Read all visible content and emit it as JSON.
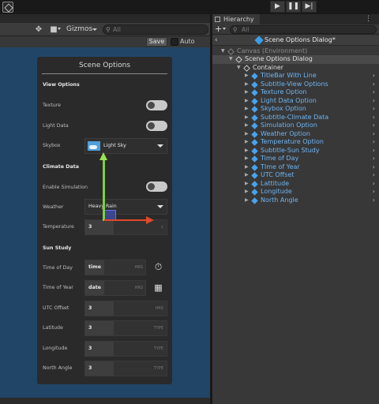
{
  "playbar": {
    "play": "▶",
    "pause": "❚❚",
    "step": "▶|"
  },
  "scene": {
    "toolbar": {
      "gizmos_label": "Gizmos",
      "search_placeholder": "All"
    },
    "save_label": "Save",
    "autosave_label": "Auto Save"
  },
  "dialog": {
    "title": "Scene Options",
    "sections": {
      "view_options": "View Options",
      "climate_data": "Climate Data",
      "sun_study": "Sun Study"
    },
    "texture_label": "Texture",
    "light_data_label": "Light Data",
    "skybox_label": "Skybox",
    "skybox_value": "Light Sky",
    "enable_simulation_label": "Enable Simulation",
    "weather_label": "Weather",
    "weather_value": "Heavy Rain",
    "temperature_label": "Temperature",
    "temperature_value": "3",
    "temperature_unit": "c",
    "time_of_day_label": "Time of Day",
    "time_of_day_value": "time",
    "time_of_day_unit": "HRS",
    "time_of_year_label": "Time of Year",
    "time_of_year_value": "date",
    "time_of_year_unit": "HRS",
    "utc_offset_label": "UTC Offset",
    "utc_offset_value": "3",
    "utc_offset_unit": "HRS",
    "latitude_label": "Latitude",
    "latitude_value": "3",
    "latitude_unit": "TYPE",
    "longitude_label": "Longitude",
    "longitude_value": "3",
    "longitude_unit": "TYPE",
    "north_angle_label": "North Angle",
    "north_angle_value": "3",
    "north_angle_unit": "TYPE",
    "toggles": {
      "texture": false,
      "light_data": false,
      "enable_simulation": false
    }
  },
  "hierarchy": {
    "tab_label": "Hierarchy",
    "search_placeholder": "All",
    "prefab_title": "Scene Options Dialog*",
    "rows": [
      {
        "label": "Canvas (Environment)",
        "depth": 0,
        "style": "gray",
        "expanded": true
      },
      {
        "label": "Scene Options Dialog",
        "depth": 1,
        "style": "white",
        "expanded": true
      },
      {
        "label": "Container",
        "depth": 2,
        "style": "white",
        "expanded": true
      },
      {
        "label": "TitleBar With Line",
        "depth": 3,
        "style": "blue"
      },
      {
        "label": "Subtitle-View Options",
        "depth": 3,
        "style": "blue"
      },
      {
        "label": "Texture Option",
        "depth": 3,
        "style": "blue"
      },
      {
        "label": "Light Data Option",
        "depth": 3,
        "style": "blue"
      },
      {
        "label": "Skybox Option",
        "depth": 3,
        "style": "blue"
      },
      {
        "label": "Subtitle-Climate Data",
        "depth": 3,
        "style": "blue"
      },
      {
        "label": "Simulation Option",
        "depth": 3,
        "style": "blue"
      },
      {
        "label": "Weather Option",
        "depth": 3,
        "style": "blue"
      },
      {
        "label": "Temperature Option",
        "depth": 3,
        "style": "blue"
      },
      {
        "label": "Subtitle-Sun Study",
        "depth": 3,
        "style": "blue"
      },
      {
        "label": "Time of Day",
        "depth": 3,
        "style": "blue"
      },
      {
        "label": "TIme of Year",
        "depth": 3,
        "style": "blue"
      },
      {
        "label": "UTC Offset",
        "depth": 3,
        "style": "blue"
      },
      {
        "label": "Lattitude",
        "depth": 3,
        "style": "blue"
      },
      {
        "label": "Longitude",
        "depth": 3,
        "style": "blue"
      },
      {
        "label": "North Angle",
        "depth": 3,
        "style": "blue"
      }
    ]
  },
  "icons": {
    "unity": "unity-logo-icon",
    "hand_tool": "hand-tool-icon",
    "camera": "camera-icon",
    "search": "search-icon",
    "timer": "timer-icon",
    "calendar": "calendar-icon"
  },
  "colors": {
    "viewport_bg": "#214566",
    "dialog_bg": "#2a2a2a",
    "hierarchy_blue_text": "#6fb4f2",
    "gizmo_y": "#7fcf3f",
    "gizmo_x": "#e0482a"
  }
}
